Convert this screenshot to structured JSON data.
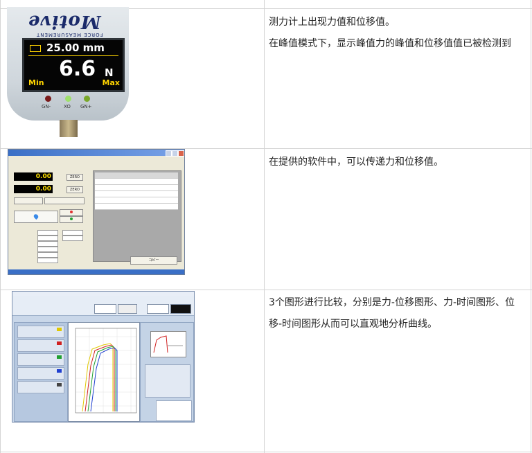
{
  "rows": [
    {
      "image": {
        "kind": "force-gauge-photo",
        "brand": "Motive",
        "brand_sub": "FORCE MEASUREMENT",
        "displacement_reading": "25.00 mm",
        "force_value": "6.6",
        "force_unit": "N",
        "min_label": "Min",
        "max_label": "Max",
        "led_labels": [
          "GN-",
          "XO",
          "GN+"
        ],
        "led_colors": [
          "#7a1a1a",
          "#9ee06a",
          "#7aa82a"
        ]
      },
      "paragraphs": [
        "测力计上出现力值和位移值。",
        "在峰值模式下，显示峰值力的峰值和位移值值已被检测到"
      ]
    },
    {
      "image": {
        "kind": "software-window-screenshot",
        "force_reading": "0.00",
        "displacement_reading": "0.00",
        "zero_label": "ZERO",
        "copy_label": "コピー"
      },
      "paragraphs": [
        "在提供的软件中，可以传递力和位移值。"
      ]
    },
    {
      "image": {
        "kind": "graph-software-screenshot",
        "curve_colors": [
          "#e0c800",
          "#d02020",
          "#20a030",
          "#2040d0"
        ]
      },
      "paragraphs": [
        "3个图形进行比较，分别是力-位移图形、力-时间图形、位移-时间图形从而可以直观地分析曲线。"
      ]
    }
  ]
}
